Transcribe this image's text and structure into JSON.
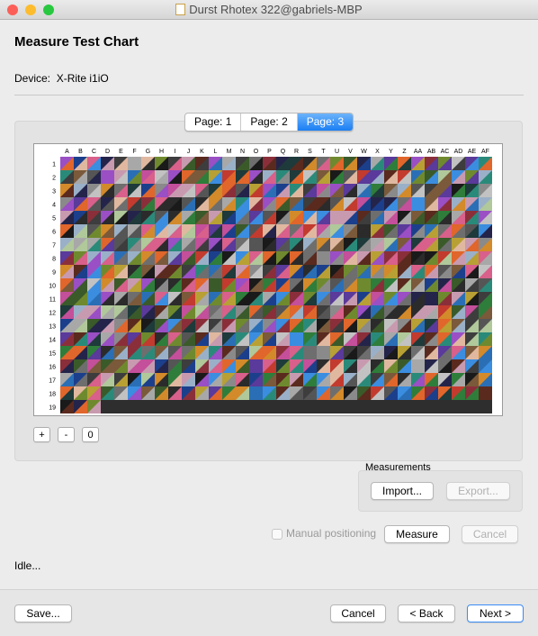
{
  "window": {
    "title": "Durst Rhotex 322@gabriels-MBP",
    "lights": [
      "#fc5f57",
      "#fdbc2e",
      "#28c840"
    ]
  },
  "heading": "Measure Test Chart",
  "device": {
    "label": "Device:",
    "value": "X-Rite i1iO"
  },
  "pages": {
    "tabs": [
      "Page: 1",
      "Page: 2",
      "Page: 3"
    ],
    "active": 2
  },
  "chart": {
    "columns": [
      "A",
      "B",
      "C",
      "D",
      "E",
      "F",
      "G",
      "H",
      "I",
      "J",
      "K",
      "L",
      "M",
      "N",
      "O",
      "P",
      "Q",
      "R",
      "S",
      "T",
      "U",
      "V",
      "W",
      "X",
      "Y",
      "Z",
      "AA",
      "AB",
      "AC",
      "AD",
      "AE",
      "AF"
    ],
    "rows": [
      "1",
      "2",
      "3",
      "4",
      "5",
      "6",
      "7",
      "8",
      "9",
      "10",
      "11",
      "12",
      "13",
      "14",
      "15",
      "16",
      "17",
      "18",
      "19"
    ],
    "filled_patches_in_last_row": 3,
    "palette": [
      "#1a1a1a",
      "#2b2b2b",
      "#3d3d3d",
      "#555555",
      "#6e6e6e",
      "#8a8a8a",
      "#a8a8a8",
      "#c2c2c2",
      "#c23b2e",
      "#e0662b",
      "#d38a2a",
      "#b8a034",
      "#6f8a2e",
      "#2f7d3a",
      "#2a8a7a",
      "#2a6fb5",
      "#3b8de0",
      "#1c3f8c",
      "#5a3a9a",
      "#9a4fc4",
      "#c44f9a",
      "#d8608a",
      "#8a2f3a",
      "#5a2a1e",
      "#7a5a3a",
      "#3a5a2a",
      "#1e3a3a",
      "#24244a",
      "#9ab0c8",
      "#c89ab0",
      "#b0c89a",
      "#e0b8a0"
    ]
  },
  "zoom": {
    "plus": "+",
    "minus": "-",
    "reset": "0"
  },
  "measurements": {
    "group_label": "Measurements",
    "import": "Import...",
    "export": "Export..."
  },
  "manual_positioning": {
    "label": "Manual positioning",
    "checked": false
  },
  "measure_button": "Measure",
  "cancel_button_top": "Cancel",
  "status": "Idle...",
  "bottom": {
    "save": "Save...",
    "cancel": "Cancel",
    "back": "< Back",
    "next": "Next >"
  }
}
